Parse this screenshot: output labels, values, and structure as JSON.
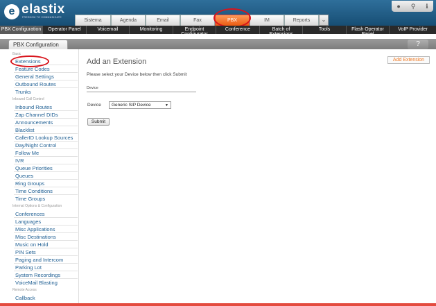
{
  "brand": {
    "name": "elastix",
    "tagline": "FREEDOM TO COMMUNICATE"
  },
  "tabs": [
    {
      "label": "Sistema"
    },
    {
      "label": "Agenda"
    },
    {
      "label": "Email"
    },
    {
      "label": "Fax"
    },
    {
      "label": "PBX",
      "active": true
    },
    {
      "label": "IM"
    },
    {
      "label": "Reports"
    }
  ],
  "top_icons": [
    "drop-icon",
    "search-icon",
    "info-icon"
  ],
  "modules": [
    {
      "label": "PBX Configuration",
      "active": true
    },
    {
      "label": "Operator Panel"
    },
    {
      "label": "Voicemail"
    },
    {
      "label": "Monitoring"
    },
    {
      "label": "Endpoint Configurator"
    },
    {
      "label": "Conference"
    },
    {
      "label": "Batch of Extensions"
    },
    {
      "label": "Tools"
    },
    {
      "label": "Flash Operator Panel"
    },
    {
      "label": "VoIP Provider"
    }
  ],
  "panel": {
    "title": "PBX Configuration",
    "help": "?"
  },
  "sidebar": {
    "basic": {
      "label": "Basic",
      "items": [
        "Extensions",
        "Feature Codes",
        "General Settings",
        "Outbound Routes",
        "Trunks"
      ]
    },
    "inbound": {
      "label": "Inbound Call Control",
      "items": [
        "Inbound Routes",
        "Zap Channel DIDs",
        "Announcements",
        "Blacklist",
        "CallerID Lookup Sources",
        "Day/Night Control",
        "Follow Me",
        "IVR",
        "Queue Priorities",
        "Queues",
        "Ring Groups",
        "Time Conditions",
        "Time Groups"
      ]
    },
    "internal": {
      "label": "Internal Options & Configuration",
      "items": [
        "Conferences",
        "Languages",
        "Misc Applications",
        "Misc Destinations",
        "Music on Hold",
        "PIN Sets",
        "Paging and Intercom",
        "Parking Lot",
        "System Recordings",
        "VoiceMail Blasting"
      ]
    },
    "remote": {
      "label": "Remote Access",
      "items": [
        "Callback"
      ]
    }
  },
  "main": {
    "title": "Add an Extension",
    "add_button": "Add Extension",
    "instruction": "Please select your Device below then click Submit",
    "section": "Device",
    "device_label": "Device",
    "device_value": "Generic SIP Device",
    "submit": "Submit"
  }
}
